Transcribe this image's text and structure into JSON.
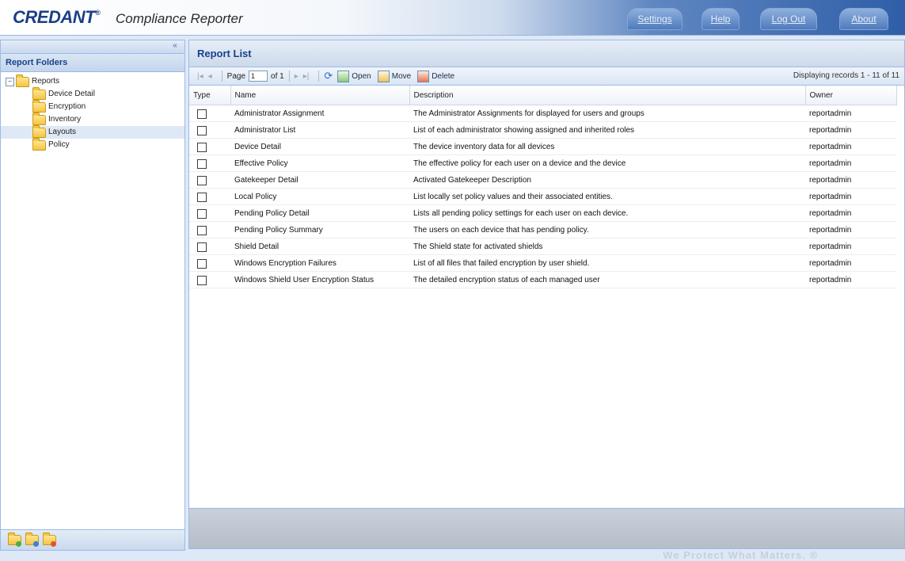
{
  "header": {
    "brand": "CREDANT",
    "brand_mark": "®",
    "product": "Compliance Reporter",
    "nav": [
      {
        "label": "Settings"
      },
      {
        "label": "Help"
      },
      {
        "label": "Log Out"
      },
      {
        "label": "About"
      }
    ]
  },
  "sidebar": {
    "collapse_icon": "«",
    "title": "Report Folders",
    "root": {
      "label": "Reports",
      "expander": "−"
    },
    "folders": [
      {
        "label": "Device Detail"
      },
      {
        "label": "Encryption"
      },
      {
        "label": "Inventory"
      },
      {
        "label": "Layouts",
        "selected": true
      },
      {
        "label": "Policy"
      }
    ],
    "bottom_icons": [
      "new-folder-icon",
      "edit-folder-icon",
      "delete-folder-icon"
    ]
  },
  "main": {
    "title": "Report List",
    "toolbar": {
      "first_icon": "|◂",
      "prev_icon": "◂",
      "page_label": "Page",
      "page_value": "1",
      "of_label": "of 1",
      "next_icon": "▸",
      "last_icon": "▸|",
      "refresh_icon": "⟳",
      "open_label": "Open",
      "move_label": "Move",
      "delete_label": "Delete",
      "displaying": "Displaying records 1 - 11 of 11"
    },
    "columns": {
      "type": "Type",
      "name": "Name",
      "description": "Description",
      "owner": "Owner"
    },
    "rows": [
      {
        "name": "Administrator Assignment",
        "description": "The Administrator Assignments for displayed for users and groups",
        "owner": "reportadmin"
      },
      {
        "name": "Administrator List",
        "description": "List of each administrator showing assigned and inherited roles",
        "owner": "reportadmin"
      },
      {
        "name": "Device Detail",
        "description": "The device inventory data for all devices",
        "owner": "reportadmin"
      },
      {
        "name": "Effective Policy",
        "description": "The effective policy for each user on a device and the device",
        "owner": "reportadmin"
      },
      {
        "name": "Gatekeeper Detail",
        "description": "Activated Gatekeeper Description",
        "owner": "reportadmin"
      },
      {
        "name": "Local Policy",
        "description": "List locally set policy values and their associated entities.",
        "owner": "reportadmin"
      },
      {
        "name": "Pending Policy Detail",
        "description": "Lists all pending policy settings for each user on each device.",
        "owner": "reportadmin"
      },
      {
        "name": "Pending Policy Summary",
        "description": "The users on each device that has pending policy.",
        "owner": "reportadmin"
      },
      {
        "name": "Shield Detail",
        "description": "The Shield state for activated shields",
        "owner": "reportadmin"
      },
      {
        "name": "Windows Encryption Failures",
        "description": "List of all files that failed encryption by user shield.",
        "owner": "reportadmin"
      },
      {
        "name": "Windows Shield User Encryption Status",
        "description": "The detailed encryption status of each managed user",
        "owner": "reportadmin"
      }
    ]
  },
  "footer": {
    "tagline": "We Protect What Matters. ®"
  },
  "colors": {
    "brand_blue": "#1b3f86",
    "panel_title": "#15428b",
    "panel_border": "#99bbe8"
  }
}
